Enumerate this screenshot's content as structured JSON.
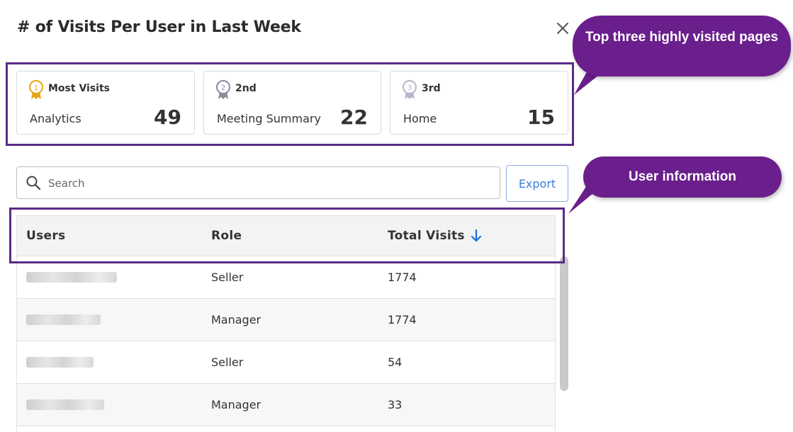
{
  "dialog": {
    "title": "# of Visits Per User in Last Week",
    "close_icon": "close-icon"
  },
  "top_pages": [
    {
      "rank": "Most Visits",
      "page": "Analytics",
      "count": "49",
      "medal": "gold-medal-icon",
      "color": "#e8a317"
    },
    {
      "rank": "2nd",
      "page": "Meeting Summary",
      "count": "22",
      "medal": "silver-medal-icon",
      "color": "#8a8aa0"
    },
    {
      "rank": "3rd",
      "page": "Home",
      "count": "15",
      "medal": "bronze-medal-icon",
      "color": "#b9b3cc"
    }
  ],
  "search": {
    "placeholder": "Search",
    "value": ""
  },
  "export_label": "Export",
  "table": {
    "headers": {
      "users": "Users",
      "role": "Role",
      "total_visits": "Total Visits"
    },
    "sort": "descending",
    "rows": [
      {
        "user": "",
        "role": "Seller",
        "visits": "1774"
      },
      {
        "user": "",
        "role": "Manager",
        "visits": "1774"
      },
      {
        "user": "",
        "role": "Seller",
        "visits": "54"
      },
      {
        "user": "",
        "role": "Manager",
        "visits": "33"
      }
    ]
  },
  "callouts": {
    "top_pages": "Top three highly visited pages",
    "user_info": "User information"
  },
  "colors": {
    "accent": "#3b7dd8",
    "callout": "#6a1f8c",
    "highlight": "#5b2a86"
  }
}
